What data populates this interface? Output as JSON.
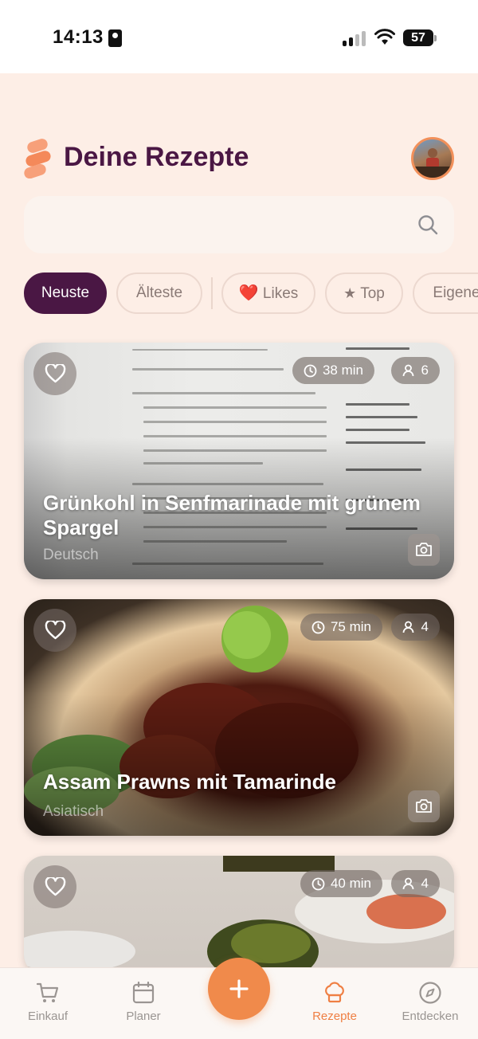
{
  "status_bar": {
    "time": "14:13",
    "battery": "57"
  },
  "header": {
    "title": "Deine Rezepte"
  },
  "search": {
    "placeholder": ""
  },
  "filters": [
    {
      "label": "Neuste",
      "active": true
    },
    {
      "label": "Älteste",
      "active": false
    },
    {
      "label": "Likes",
      "icon": "heart-icon",
      "active": false
    },
    {
      "label": "Top",
      "icon": "star-icon",
      "active": false
    },
    {
      "label": "Eigene",
      "active": false
    }
  ],
  "recipes": [
    {
      "title": "Grünkohl in Senfmarinade mit grünem Spargel",
      "category": "Deutsch",
      "time": "38 min",
      "servings": "6"
    },
    {
      "title": "Assam Prawns mit Tamarinde",
      "category": "Asiatisch",
      "time": "75 min",
      "servings": "4"
    },
    {
      "title": "",
      "category": "",
      "time": "40 min",
      "servings": "4"
    }
  ],
  "nav": {
    "items": [
      {
        "label": "Einkauf",
        "icon": "cart-icon"
      },
      {
        "label": "Planer",
        "icon": "calendar-icon"
      },
      {
        "label": "Rezepte",
        "icon": "chef-hat-icon",
        "active": true
      },
      {
        "label": "Entdecken",
        "icon": "compass-icon"
      }
    ],
    "fab_icon": "plus-icon"
  },
  "colors": {
    "accent": "#f08a4b",
    "brand": "#4a1744",
    "background": "#fdeee6"
  }
}
